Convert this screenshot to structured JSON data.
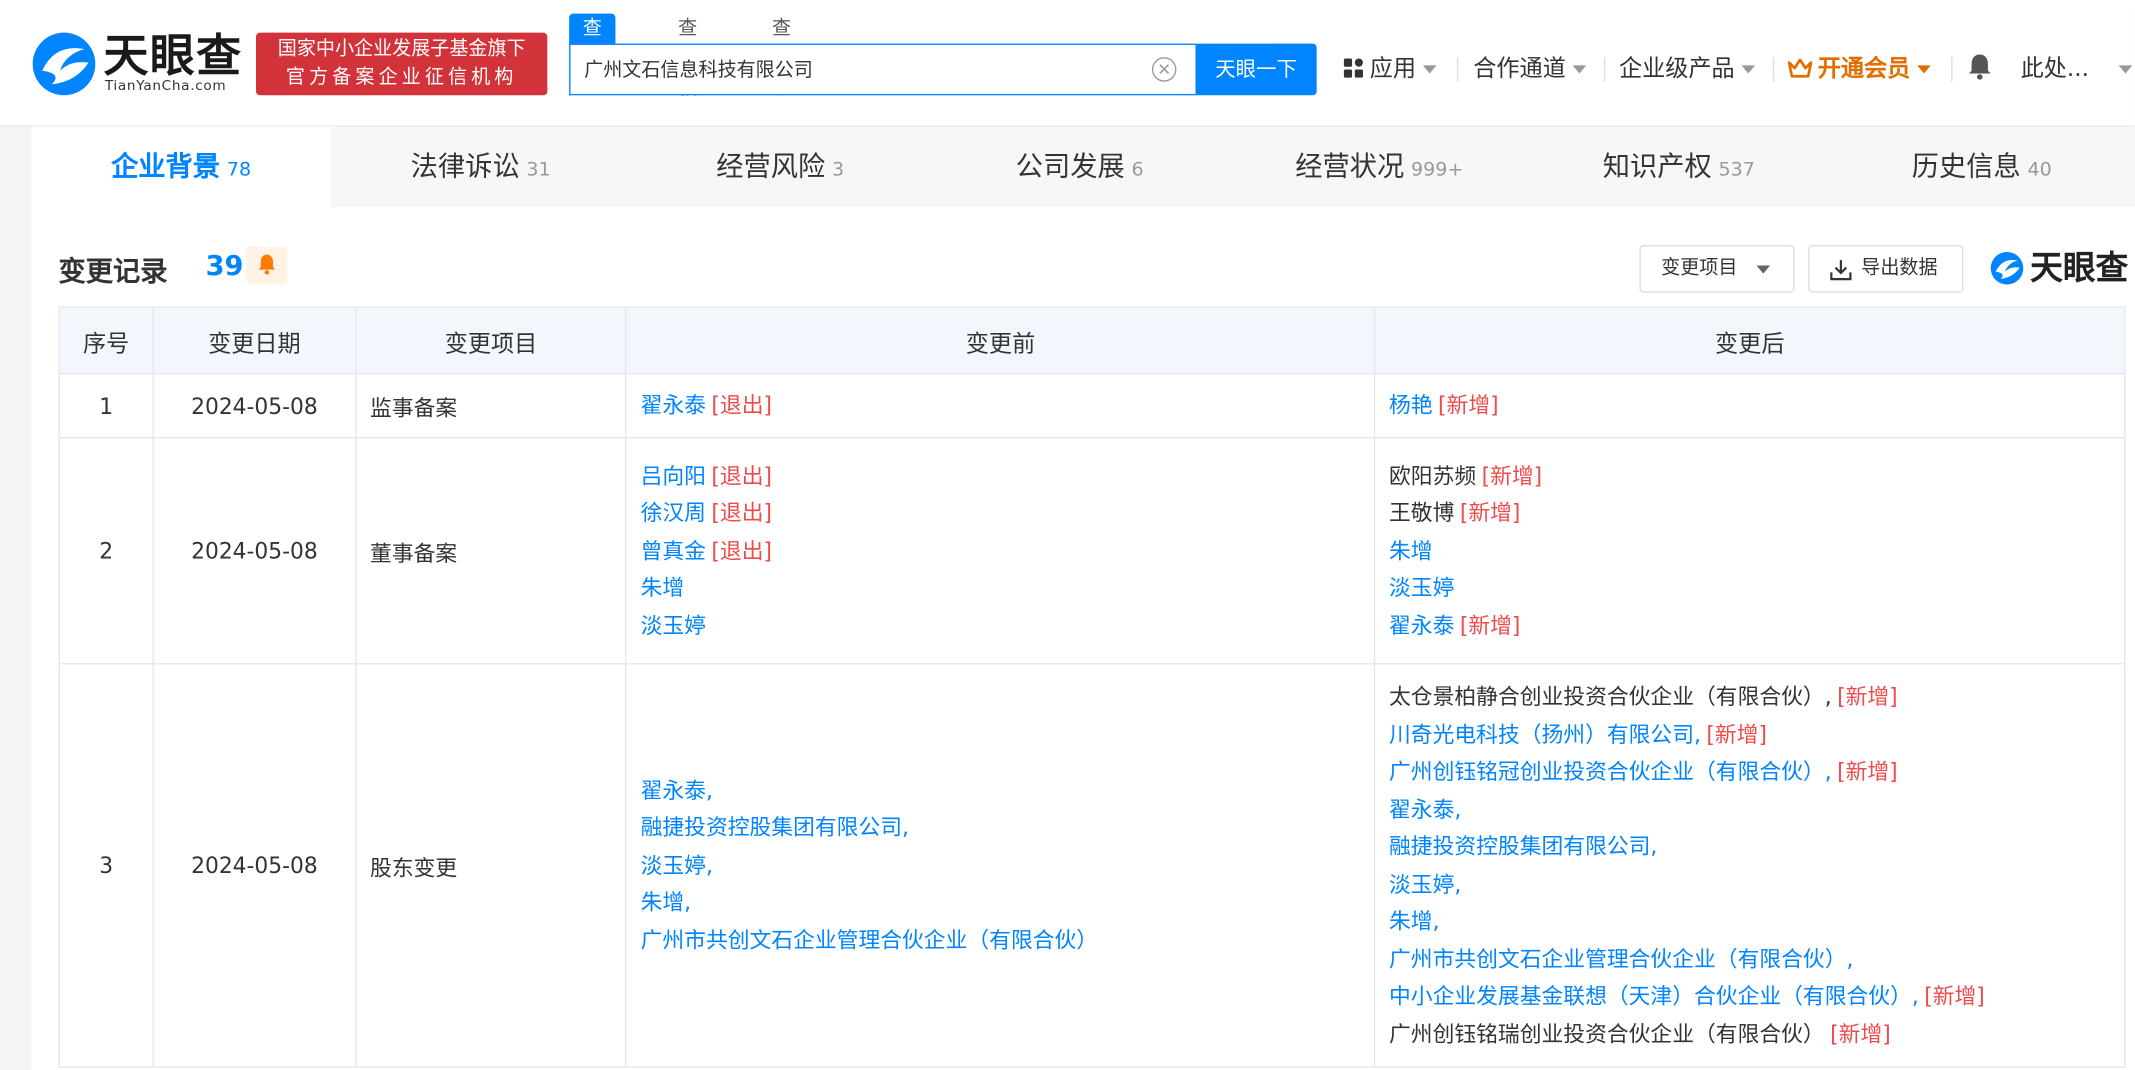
{
  "brand": {
    "name": "天眼查",
    "domain": "TianYanCha.com",
    "badge_line1": "国家中小企业发展子基金旗下",
    "badge_line2": "官方备案企业征信机构"
  },
  "search": {
    "tabs": [
      "查公司",
      "查老板",
      "查关系"
    ],
    "value": "广州文石信息科技有限公司",
    "button": "天眼一下"
  },
  "nav": {
    "apps": "应用",
    "partner": "合作通道",
    "enterprise": "企业级产品",
    "vip": "开通会员",
    "more": "此处..."
  },
  "tabs": [
    {
      "label": "企业背景",
      "count": "78"
    },
    {
      "label": "法律诉讼",
      "count": "31"
    },
    {
      "label": "经营风险",
      "count": "3"
    },
    {
      "label": "公司发展",
      "count": "6"
    },
    {
      "label": "经营状况",
      "count": "999+"
    },
    {
      "label": "知识产权",
      "count": "537"
    },
    {
      "label": "历史信息",
      "count": "40"
    }
  ],
  "section": {
    "title": "变更记录",
    "count": "39",
    "filter": "变更项目",
    "export": "导出数据",
    "watermark": "天眼查"
  },
  "table": {
    "headers": [
      "序号",
      "变更日期",
      "变更项目",
      "变更前",
      "变更后"
    ],
    "rows": [
      {
        "no": "1",
        "date": "2024-05-08",
        "item": "监事备案",
        "before": [
          {
            "name": "翟永泰",
            "tag": "[退出]",
            "link": true
          }
        ],
        "after": [
          {
            "name": "杨艳",
            "tag": "[新增]",
            "link": true
          }
        ]
      },
      {
        "no": "2",
        "date": "2024-05-08",
        "item": "董事备案",
        "before": [
          {
            "name": "吕向阳",
            "tag": "[退出]",
            "link": true
          },
          {
            "name": "徐汉周",
            "tag": "[退出]",
            "link": true
          },
          {
            "name": "曾真金",
            "tag": "[退出]",
            "link": true
          },
          {
            "name": "朱增",
            "tag": "",
            "link": true
          },
          {
            "name": "淡玉婷",
            "tag": "",
            "link": true
          }
        ],
        "after": [
          {
            "name": "欧阳苏频",
            "tag": "[新增]",
            "link": false
          },
          {
            "name": "王敬博",
            "tag": "[新增]",
            "link": false
          },
          {
            "name": "朱增",
            "tag": "",
            "link": true
          },
          {
            "name": "淡玉婷",
            "tag": "",
            "link": true
          },
          {
            "name": "翟永泰",
            "tag": "[新增]",
            "link": true
          }
        ]
      },
      {
        "no": "3",
        "date": "2024-05-08",
        "item": "股东变更",
        "before": [
          {
            "name": "翟永泰,",
            "tag": "",
            "link": true
          },
          {
            "name": "融捷投资控股集团有限公司,",
            "tag": "",
            "link": true
          },
          {
            "name": "淡玉婷,",
            "tag": "",
            "link": true
          },
          {
            "name": "朱增,",
            "tag": "",
            "link": true
          },
          {
            "name": "广州市共创文石企业管理合伙企业（有限合伙）",
            "tag": "",
            "link": true
          }
        ],
        "after": [
          {
            "name": "太仓景柏静合创业投资合伙企业（有限合伙）,",
            "tag": "[新增]",
            "link": false
          },
          {
            "name": "川奇光电科技（扬州）有限公司,",
            "tag": "[新增]",
            "link": true
          },
          {
            "name": "广州创钰铭冠创业投资合伙企业（有限合伙）,",
            "tag": "[新增]",
            "link": true
          },
          {
            "name": "翟永泰,",
            "tag": "",
            "link": true
          },
          {
            "name": "融捷投资控股集团有限公司,",
            "tag": "",
            "link": true
          },
          {
            "name": "淡玉婷,",
            "tag": "",
            "link": true
          },
          {
            "name": "朱增,",
            "tag": "",
            "link": true
          },
          {
            "name": "广州市共创文石企业管理合伙企业（有限合伙）,",
            "tag": "",
            "link": true
          },
          {
            "name": "中小企业发展基金联想（天津）合伙企业（有限合伙）,",
            "tag": "[新增]",
            "link": true
          },
          {
            "name": "广州创钰铭瑞创业投资合伙企业（有限合伙）",
            "tag": "[新增]",
            "link": false
          }
        ]
      }
    ]
  }
}
